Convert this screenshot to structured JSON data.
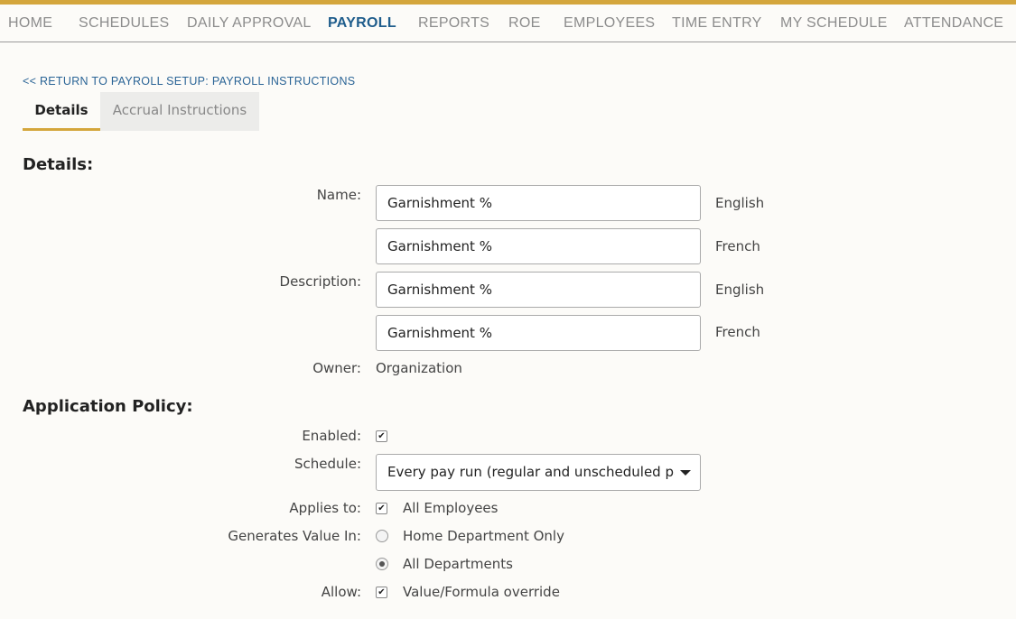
{
  "nav": {
    "items": [
      {
        "label": "HOME"
      },
      {
        "label": "SCHEDULES"
      },
      {
        "label": "DAILY APPROVAL"
      },
      {
        "label": "PAYROLL"
      },
      {
        "label": "REPORTS"
      },
      {
        "label": "ROE"
      },
      {
        "label": "EMPLOYEES"
      },
      {
        "label": "TIME ENTRY"
      },
      {
        "label": "MY SCHEDULE"
      },
      {
        "label": "ATTENDANCE"
      }
    ],
    "active": "PAYROLL",
    "accent_color": "#d4a63c",
    "active_color": "#1f5d8c"
  },
  "return_link": "<< RETURN TO PAYROLL SETUP: PAYROLL INSTRUCTIONS",
  "tabs": {
    "details": "Details",
    "accrual": "Accrual Instructions",
    "selected": "Details"
  },
  "details": {
    "heading": "Details:",
    "name_label": "Name:",
    "name_english": "Garnishment %",
    "name_french": "Garnishment %",
    "description_label": "Description:",
    "description_english": "Garnishment %",
    "description_french": "Garnishment %",
    "lang_english": "English",
    "lang_french": "French",
    "owner_label": "Owner:",
    "owner_value": "Organization"
  },
  "policy": {
    "heading": "Application Policy:",
    "enabled_label": "Enabled:",
    "enabled": true,
    "schedule_label": "Schedule:",
    "schedule_value": "Every pay run (regular and unscheduled pay runs)",
    "applies_label": "Applies to:",
    "applies_value": "All Employees",
    "applies_checked": true,
    "generates_label": "Generates Value In:",
    "generates_options": [
      "Home Department Only",
      "All Departments"
    ],
    "generates_selected": "All Departments",
    "allow_label": "Allow:",
    "allow_value": "Value/Formula override",
    "allow_checked": true
  }
}
